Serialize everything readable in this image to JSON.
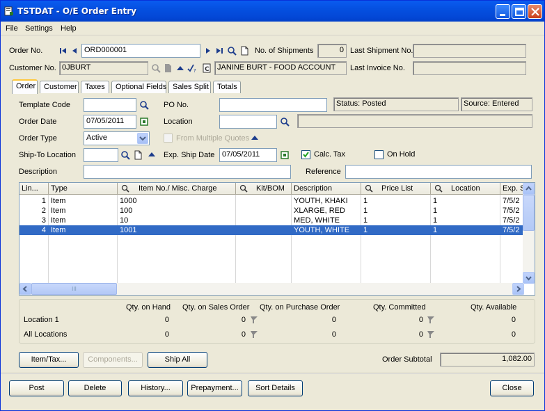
{
  "window": {
    "title": "TSTDAT - O/E Order Entry",
    "controls": {
      "minimize": "minimize-icon",
      "maximize": "maximize-icon",
      "close": "close-icon"
    }
  },
  "menu": [
    "File",
    "Settings",
    "Help"
  ],
  "header": {
    "order_no_label": "Order No.",
    "order_no_value": "ORD000001",
    "no_of_shipments_label": "No. of Shipments",
    "no_of_shipments_value": "0",
    "last_shipment_label": "Last Shipment No.",
    "last_shipment_value": "",
    "customer_no_label": "Customer No.",
    "customer_no_value": "0JBURT",
    "customer_name": "JANINE BURT - FOOD ACCOUNT",
    "last_invoice_label": "Last Invoice No.",
    "last_invoice_value": ""
  },
  "tabs": [
    "Order",
    "Customer",
    "Taxes",
    "Optional Fields",
    "Sales Split",
    "Totals"
  ],
  "order_tab": {
    "template_code_label": "Template Code",
    "template_code_value": "",
    "po_no_label": "PO No.",
    "po_no_value": "",
    "status": "Status: Posted",
    "source": "Source: Entered",
    "order_date_label": "Order Date",
    "order_date_value": "07/05/2011",
    "location_label": "Location",
    "location_value": "",
    "location_desc": "",
    "order_type_label": "Order Type",
    "order_type_value": "Active",
    "from_multiple_quotes": "From Multiple Quotes",
    "ship_to_label": "Ship-To Location",
    "ship_to_value": "",
    "exp_ship_date_label": "Exp. Ship Date",
    "exp_ship_date_value": "07/05/2011",
    "calc_tax_label": "Calc. Tax",
    "calc_tax_checked": true,
    "on_hold_label": "On Hold",
    "on_hold_checked": false,
    "description_label": "Description",
    "description_value": "",
    "reference_label": "Reference",
    "reference_value": ""
  },
  "grid": {
    "columns": [
      "Lin...",
      "Type",
      "Item No./ Misc. Charge",
      "Kit/BOM",
      "Description",
      "Price List",
      "Location",
      "Exp. S"
    ],
    "searchable_columns": [
      2,
      3,
      5,
      6
    ],
    "rows": [
      {
        "line": "1",
        "type": "Item",
        "item": "1000",
        "kit": "",
        "desc": "YOUTH, KHAKI",
        "price_list": "1",
        "location": "1",
        "exp": "7/5/2"
      },
      {
        "line": "2",
        "type": "Item",
        "item": "100",
        "kit": "",
        "desc": "XLARGE, RED",
        "price_list": "1",
        "location": "1",
        "exp": "7/5/2"
      },
      {
        "line": "3",
        "type": "Item",
        "item": "10",
        "kit": "",
        "desc": "MED, WHITE",
        "price_list": "1",
        "location": "1",
        "exp": "7/5/2"
      },
      {
        "line": "4",
        "type": "Item",
        "item": "1001",
        "kit": "",
        "desc": "YOUTH, WHITE",
        "price_list": "1",
        "location": "1",
        "exp": "7/5/2",
        "selected": true
      }
    ],
    "scroll_thumb_glyph": "III"
  },
  "quantities": {
    "headers": [
      "Qty. on Hand",
      "Qty. on Sales Order",
      "Qty. on Purchase Order",
      "Qty. Committed",
      "Qty. Available"
    ],
    "rows": [
      {
        "label": "Location  1",
        "on_hand": "0",
        "on_sales_order": "0",
        "on_purchase_order": "0",
        "committed": "0",
        "available": "0"
      },
      {
        "label": "All Locations",
        "on_hand": "0",
        "on_sales_order": "0",
        "on_purchase_order": "0",
        "committed": "0",
        "available": "0"
      }
    ]
  },
  "detail_buttons": {
    "item_tax": "Item/Tax...",
    "components": "Components...",
    "ship_all": "Ship All"
  },
  "order_subtotal_label": "Order Subtotal",
  "order_subtotal_value": "1,082.00",
  "footer_buttons": {
    "post": "Post",
    "delete": "Delete",
    "history": "History...",
    "prepayment": "Prepayment...",
    "sort_details": "Sort Details",
    "close": "Close"
  }
}
